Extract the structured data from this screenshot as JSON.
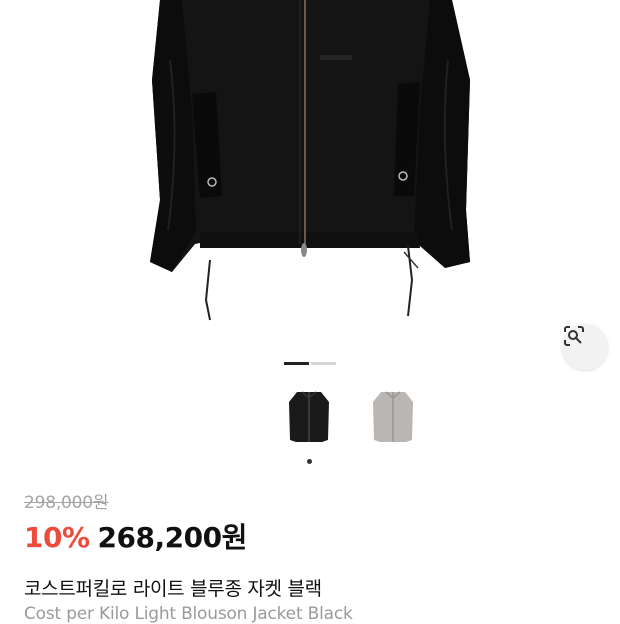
{
  "product": {
    "original_price": "298,000원",
    "discount_rate": "10%",
    "sale_price": "268,200원",
    "name_ko": "코스트퍼킬로 라이트 블루종 자켓 블랙",
    "name_en": "Cost per Kilo Light Blouson Jacket Black"
  },
  "gallery": {
    "page_count": 2,
    "active_page": 1,
    "thumbnails": [
      {
        "color": "#1a1a1a",
        "selected": true
      },
      {
        "color": "#b9b6b3",
        "selected": false
      }
    ]
  },
  "icons": {
    "lens": "lens-search-icon"
  }
}
